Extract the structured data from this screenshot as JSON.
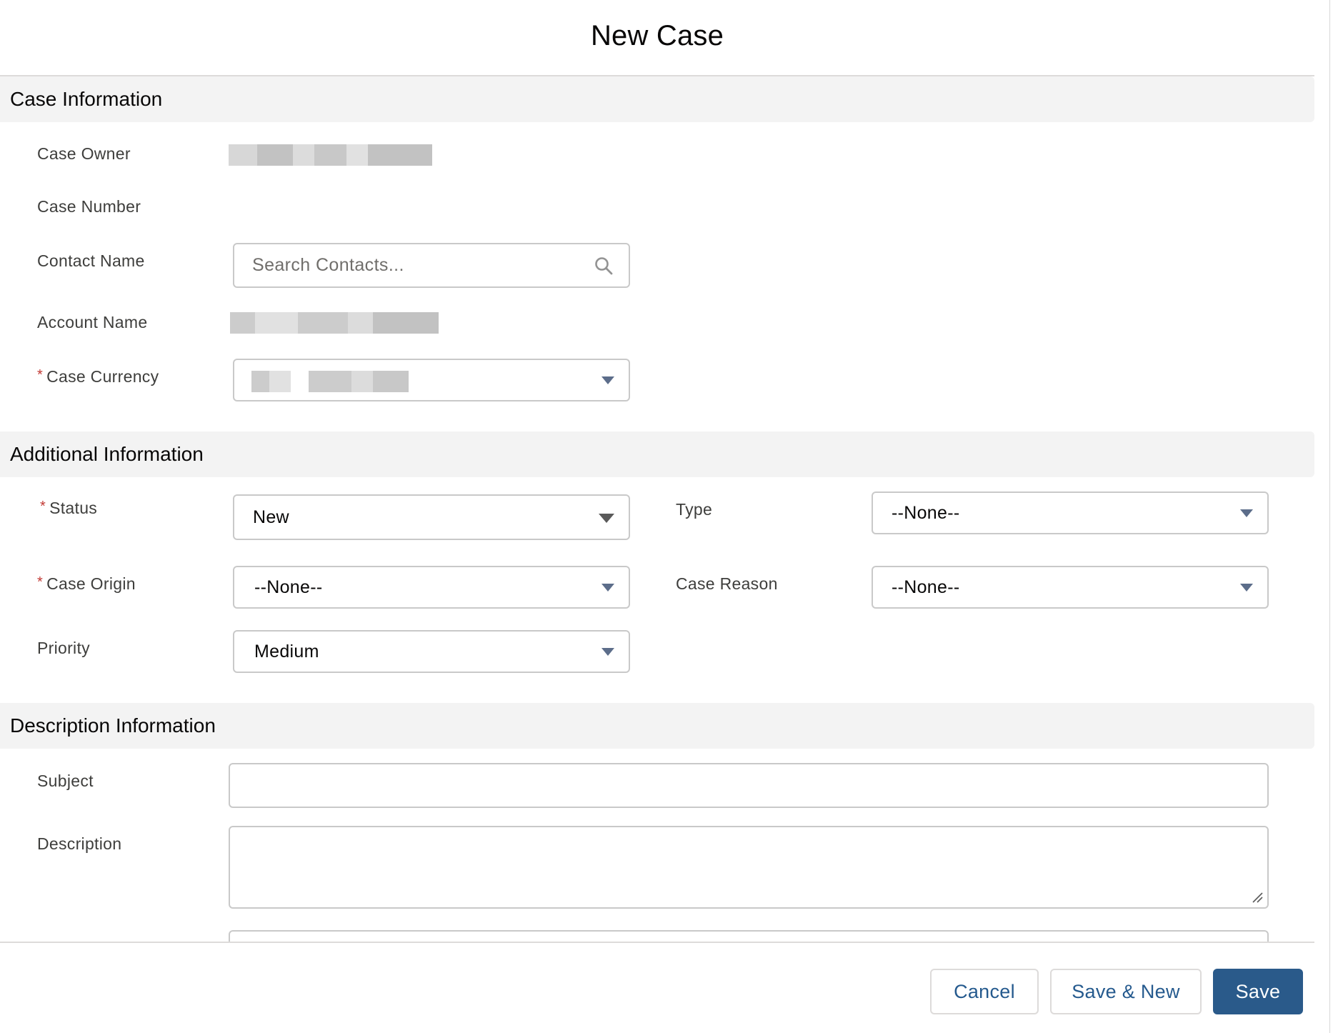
{
  "modal": {
    "title": "New Case"
  },
  "sections": {
    "case_info": {
      "title": "Case Information"
    },
    "additional_info": {
      "title": "Additional Information"
    },
    "description_info": {
      "title": "Description Information"
    }
  },
  "fields": {
    "case_owner": {
      "label": "Case Owner"
    },
    "case_number": {
      "label": "Case Number"
    },
    "contact_name": {
      "label": "Contact Name",
      "placeholder": "Search Contacts..."
    },
    "account_name": {
      "label": "Account Name"
    },
    "case_currency": {
      "label": "Case Currency",
      "required_mark": "*"
    },
    "status": {
      "label": "Status",
      "required_mark": "*",
      "value": "New"
    },
    "type": {
      "label": "Type",
      "value": "--None--"
    },
    "case_origin": {
      "label": "Case Origin",
      "required_mark": "*",
      "value": "--None--"
    },
    "case_reason": {
      "label": "Case Reason",
      "value": "--None--"
    },
    "priority": {
      "label": "Priority",
      "value": "Medium"
    },
    "subject": {
      "label": "Subject",
      "value": ""
    },
    "description": {
      "label": "Description",
      "value": ""
    }
  },
  "footer": {
    "cancel_label": "Cancel",
    "save_new_label": "Save & New",
    "save_label": "Save"
  },
  "colors": {
    "brand": "#2a5a8a",
    "required": "#c23934",
    "section_bg": "#f3f3f3",
    "caret": "#5c6d8a"
  },
  "icons": {
    "contact_search": "search-icon",
    "dropdown": "chevron-down-icon",
    "textarea_resize": "resize-grip-icon"
  }
}
